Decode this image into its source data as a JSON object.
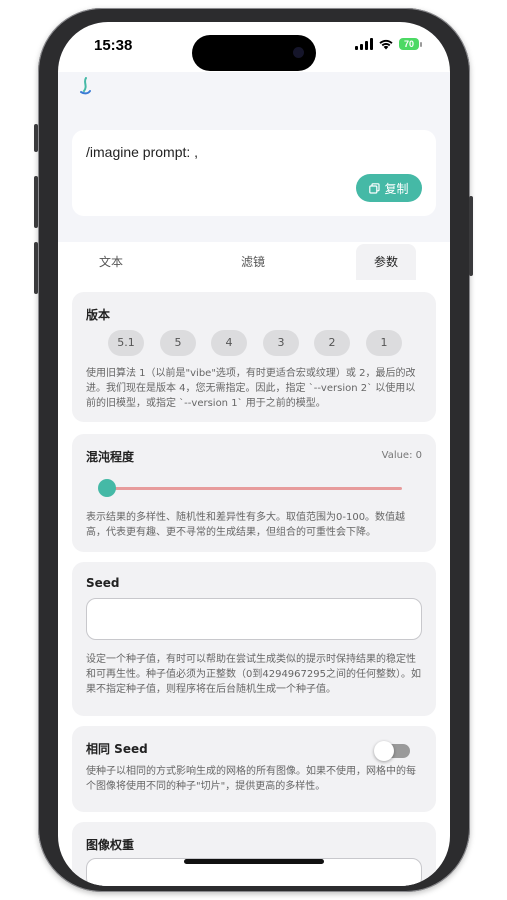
{
  "status": {
    "time": "15:38",
    "battery": "70"
  },
  "prompt": {
    "text": "/imagine prompt: ,",
    "copy_label": "复制"
  },
  "tabs": [
    {
      "label": "文本"
    },
    {
      "label": "滤镜"
    },
    {
      "label": "参数"
    }
  ],
  "version": {
    "title": "版本",
    "options": [
      "5.1",
      "5",
      "4",
      "3",
      "2",
      "1"
    ],
    "description": "使用旧算法 1（以前是\"vibe\"选项，有时更适合宏或纹理）或 2，最后的改进。我们现在是版本 4，您无需指定。因此，指定 `--version 2` 以使用以前的旧模型，或指定 `--version 1` 用于之前的模型。"
  },
  "chaos": {
    "title": "混沌程度",
    "value_label": "Value: 0",
    "value": 0,
    "description": "表示结果的多样性、随机性和差异性有多大。取值范围为0-100。数值越高，代表更有趣、更不寻常的生成结果，但组合的可重性会下降。"
  },
  "seed": {
    "title": "Seed",
    "value": "",
    "description": "设定一个种子值，有时可以帮助在尝试生成类似的提示时保持结果的稳定性和可再生性。种子值必须为正整数（0到4294967295之间的任何整数）。如果不指定种子值，则程序将在后台随机生成一个种子值。"
  },
  "same_seed": {
    "title": "相同 Seed",
    "enabled": false,
    "description": "使种子以相同的方式影响生成的网格的所有图像。如果不使用，网格中的每个图像将使用不同的种子\"切片\"，提供更高的多样性。"
  },
  "image_weight": {
    "title": "图像权重"
  },
  "colors": {
    "accent": "#45b9a6",
    "slider_track": "#e79b9b",
    "card_bg": "#f2f2f4"
  }
}
